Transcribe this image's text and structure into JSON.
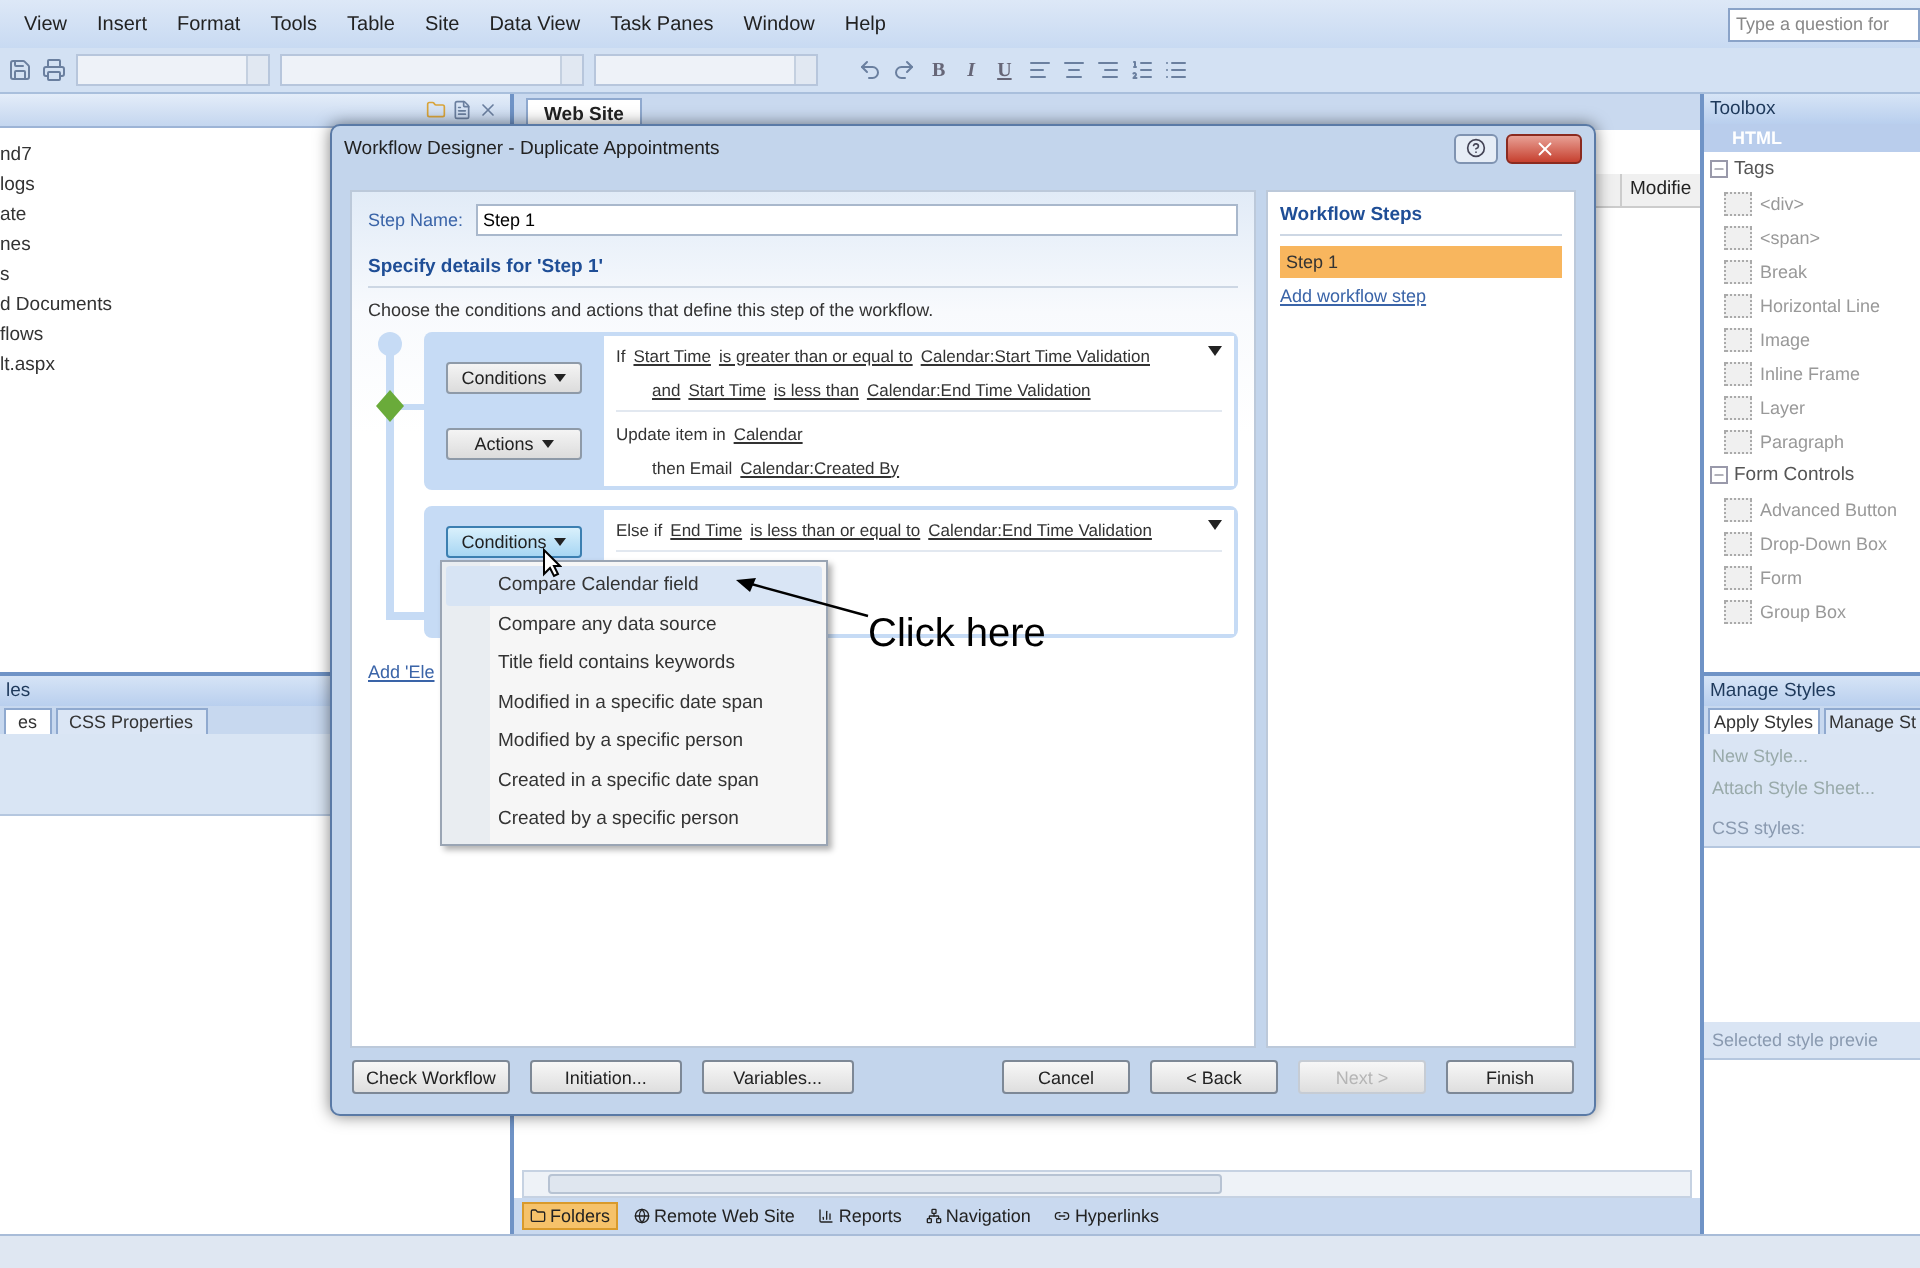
{
  "menu_bar": {
    "items": [
      "View",
      "Insert",
      "Format",
      "Tools",
      "Table",
      "Site",
      "Data View",
      "Task Panes",
      "Window",
      "Help"
    ],
    "help_search": {
      "placeholder": "Type a question for"
    }
  },
  "toolbar": {
    "format_buttons": [
      "B",
      "I",
      "U"
    ]
  },
  "folder_list": {
    "items": [
      "nd7",
      "logs",
      "ate",
      "nes",
      "s",
      "d Documents",
      "flows",
      "lt.aspx"
    ]
  },
  "styles_panel": {
    "title": "les",
    "tabs": [
      {
        "label": "es",
        "selected": true
      },
      {
        "label": "CSS Properties",
        "selected": false
      }
    ]
  },
  "editor": {
    "tab": "Web Site",
    "column_header": "Modifie",
    "view_tabs": [
      {
        "label": "Folders",
        "selected": true
      },
      {
        "label": "Remote Web Site",
        "selected": false
      },
      {
        "label": "Reports",
        "selected": false
      },
      {
        "label": "Navigation",
        "selected": false
      },
      {
        "label": "Hyperlinks",
        "selected": false
      }
    ]
  },
  "toolbox": {
    "title": "Toolbox",
    "category": "HTML",
    "groups": [
      {
        "label": "Tags",
        "expanded": true,
        "children": [
          "<div>",
          "<span>",
          "Break",
          "Horizontal Line",
          "Image",
          "Inline Frame",
          "Layer",
          "Paragraph"
        ]
      },
      {
        "label": "Form Controls",
        "expanded": true,
        "children": [
          "Advanced Button",
          "Drop-Down Box",
          "Form",
          "Group Box"
        ]
      }
    ]
  },
  "manage_styles": {
    "title": "Manage Styles",
    "tabs": [
      {
        "label": "Apply Styles",
        "selected": true
      },
      {
        "label": "Manage St",
        "selected": false
      }
    ],
    "actions": [
      "New Style...",
      "Attach Style Sheet..."
    ],
    "css_styles_label": "CSS styles:",
    "preview_label": "Selected style previe"
  },
  "dialog": {
    "title": "Workflow Designer - Duplicate Appointments",
    "step_name_label": "Step Name:",
    "step_name": "Step 1",
    "details_heading": "Specify details for 'Step 1'",
    "instructions": "Choose the conditions and actions that define this step of the workflow.",
    "branches": [
      {
        "conditions_button": {
          "label": "Conditions",
          "open": false
        },
        "actions_button": {
          "label": "Actions",
          "open": false
        },
        "condition_lines": [
          [
            {
              "text": "If",
              "link": false
            },
            {
              "text": "Start Time",
              "link": true
            },
            {
              "text": "is greater than or equal to",
              "link": true
            },
            {
              "text": "Calendar:Start Time Validation",
              "link": true
            }
          ],
          [
            {
              "text": "and",
              "link": true
            },
            {
              "text": "Start Time",
              "link": true
            },
            {
              "text": "is less than",
              "link": true
            },
            {
              "text": "Calendar:End Time Validation",
              "link": true
            }
          ]
        ],
        "action_lines": [
          [
            {
              "text": "Update item in",
              "link": false
            },
            {
              "text": "Calendar",
              "link": true
            }
          ],
          [
            {
              "text": "then Email",
              "link": false
            },
            {
              "text": "Calendar:Created By",
              "link": true
            }
          ]
        ]
      },
      {
        "conditions_button": {
          "label": "Conditions",
          "open": true
        },
        "condition_lines": [
          [
            {
              "text": "Else if",
              "link": false
            },
            {
              "text": "End Time",
              "link": true
            },
            {
              "text": "is less than or equal to",
              "link": true
            },
            {
              "text": "Calendar:End Time Validation",
              "link": true
            }
          ]
        ]
      }
    ],
    "add_branch_link": "Add 'Ele",
    "conditions_menu": [
      {
        "label": "Compare Calendar field",
        "hovered": true
      },
      {
        "label": "Compare any data source",
        "hovered": false
      },
      {
        "label": "Title field contains keywords",
        "hovered": false
      },
      {
        "label": "Modified in a specific date span",
        "hovered": false
      },
      {
        "label": "Modified by a specific person",
        "hovered": false
      },
      {
        "label": "Created in a specific date span",
        "hovered": false
      },
      {
        "label": "Created by a specific person",
        "hovered": false
      }
    ],
    "steps_panel": {
      "title": "Workflow Steps",
      "steps": [
        {
          "label": "Step 1",
          "selected": true
        }
      ],
      "add_link": "Add workflow step"
    },
    "buttons_left": [
      {
        "label": "Check Workflow",
        "disabled": false
      },
      {
        "label": "Initiation...",
        "disabled": false
      },
      {
        "label": "Variables...",
        "disabled": false
      }
    ],
    "buttons_right": [
      {
        "label": "Cancel",
        "disabled": false
      },
      {
        "label": "< Back",
        "disabled": false
      },
      {
        "label": "Next >",
        "disabled": true
      },
      {
        "label": "Finish",
        "disabled": false
      }
    ]
  },
  "annotation": {
    "text": "Click here"
  }
}
